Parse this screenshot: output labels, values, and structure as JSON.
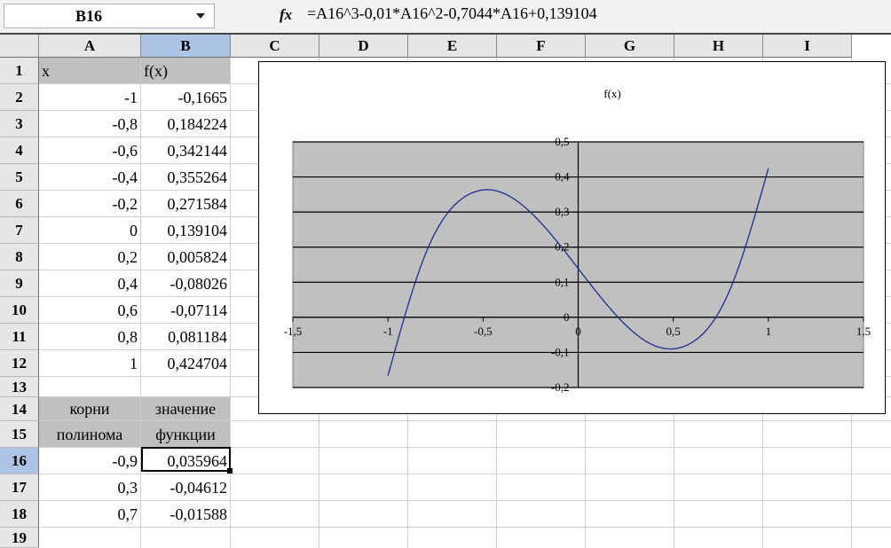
{
  "formula_bar": {
    "name_box": "B16",
    "fx_label": "fx",
    "formula": "=A16^3-0,01*A16^2-0,7044*A16+0,139104"
  },
  "columns": [
    "A",
    "B",
    "C",
    "D",
    "E",
    "F",
    "G",
    "H",
    "I"
  ],
  "rows": [
    "1",
    "2",
    "3",
    "4",
    "5",
    "6",
    "7",
    "8",
    "9",
    "10",
    "11",
    "12",
    "13",
    "14",
    "15",
    "16",
    "17",
    "18",
    "19"
  ],
  "selected": {
    "cell": "B16",
    "column": "B",
    "row": "16"
  },
  "sheet": {
    "header": {
      "a": "x",
      "b": "f(x)"
    },
    "table": [
      {
        "x": "-1",
        "fx": "-0,1665"
      },
      {
        "x": "-0,8",
        "fx": "0,184224"
      },
      {
        "x": "-0,6",
        "fx": "0,342144"
      },
      {
        "x": "-0,4",
        "fx": "0,355264"
      },
      {
        "x": "-0,2",
        "fx": "0,271584"
      },
      {
        "x": "0",
        "fx": "0,139104"
      },
      {
        "x": "0,2",
        "fx": "0,005824"
      },
      {
        "x": "0,4",
        "fx": "-0,08026"
      },
      {
        "x": "0,6",
        "fx": "-0,07114"
      },
      {
        "x": "0,8",
        "fx": "0,081184"
      },
      {
        "x": "1",
        "fx": "0,424704"
      }
    ],
    "roots_header": {
      "a14": "корни",
      "a15": "полинома",
      "b14": "значение",
      "b15": "функции"
    },
    "roots": [
      {
        "x": "-0,9",
        "fx": "0,035964"
      },
      {
        "x": "0,3",
        "fx": "-0,04612"
      },
      {
        "x": "0,7",
        "fx": "-0,01588"
      }
    ]
  },
  "chart_data": {
    "type": "line",
    "title": "f(x)",
    "xlabel": "",
    "ylabel": "",
    "xlim": [
      -1.5,
      1.5
    ],
    "ylim": [
      -0.2,
      0.5
    ],
    "x_ticks": [
      "-1,5",
      "-1",
      "-0,5",
      "0",
      "0,5",
      "1",
      "1,5"
    ],
    "y_ticks": [
      "-0,2",
      "-0,1",
      "0",
      "0,1",
      "0,2",
      "0,3",
      "0,4",
      "0,5"
    ],
    "grid": true,
    "plot_area_color": "#c0c0c0",
    "line_color": "#1c2c8c",
    "series": [
      {
        "x": [
          -1,
          -0.8,
          -0.6,
          -0.4,
          -0.2,
          0,
          0.2,
          0.4,
          0.6,
          0.8,
          1
        ],
        "y": [
          -0.1665,
          0.184224,
          0.342144,
          0.355264,
          0.271584,
          0.139104,
          0.005824,
          -0.08026,
          -0.07114,
          0.081184,
          0.424704
        ]
      }
    ]
  }
}
